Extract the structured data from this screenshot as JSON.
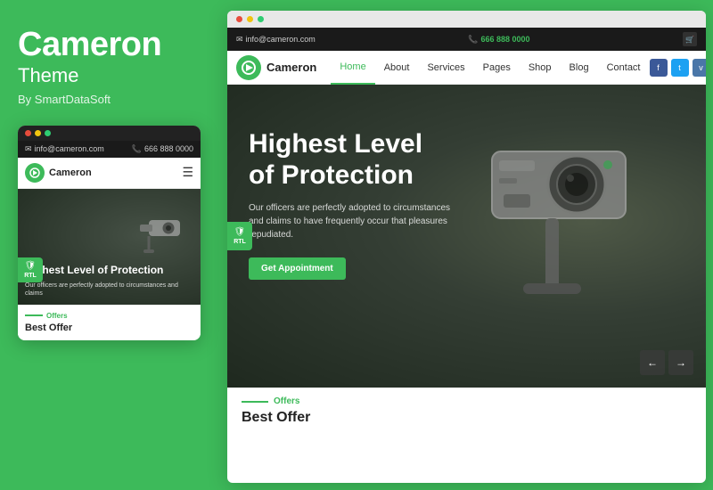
{
  "brand": {
    "name": "Cameron",
    "subtitle": "Theme",
    "by": "By SmartDataSoft"
  },
  "mobile": {
    "email": "info@cameron.com",
    "phone": "666 888 0000",
    "logo_text": "Cameron",
    "rtl_label": "RTL",
    "hero_title": "Highest Level of Protection",
    "hero_desc": "Our officers are perfectly adopted to circumstances and claims",
    "offers_label": "Offers",
    "best_offer": "Best Offer"
  },
  "browser": {
    "email": "info@cameron.com",
    "phone": "666 888 0000",
    "rtl_label": "RTL",
    "logo_text": "Cameron",
    "menu": {
      "home": "Home",
      "about": "About",
      "services": "Services",
      "pages": "Pages",
      "shop": "Shop",
      "blog": "Blog",
      "contact": "Contact"
    },
    "hero": {
      "title_line1": "Highest Level",
      "title_line2": "of Protection",
      "desc": "Our officers are perfectly adopted to circumstances and claims to have frequently occur that pleasures repudiated.",
      "cta_button": "Get Appointment"
    },
    "nav_prev": "←",
    "nav_next": "→",
    "offers_label": "Offers",
    "best_offer_title": "Best Offer"
  },
  "dots": {
    "red": "#e74c3c",
    "yellow": "#f1c40f",
    "green": "#2ecc71"
  }
}
